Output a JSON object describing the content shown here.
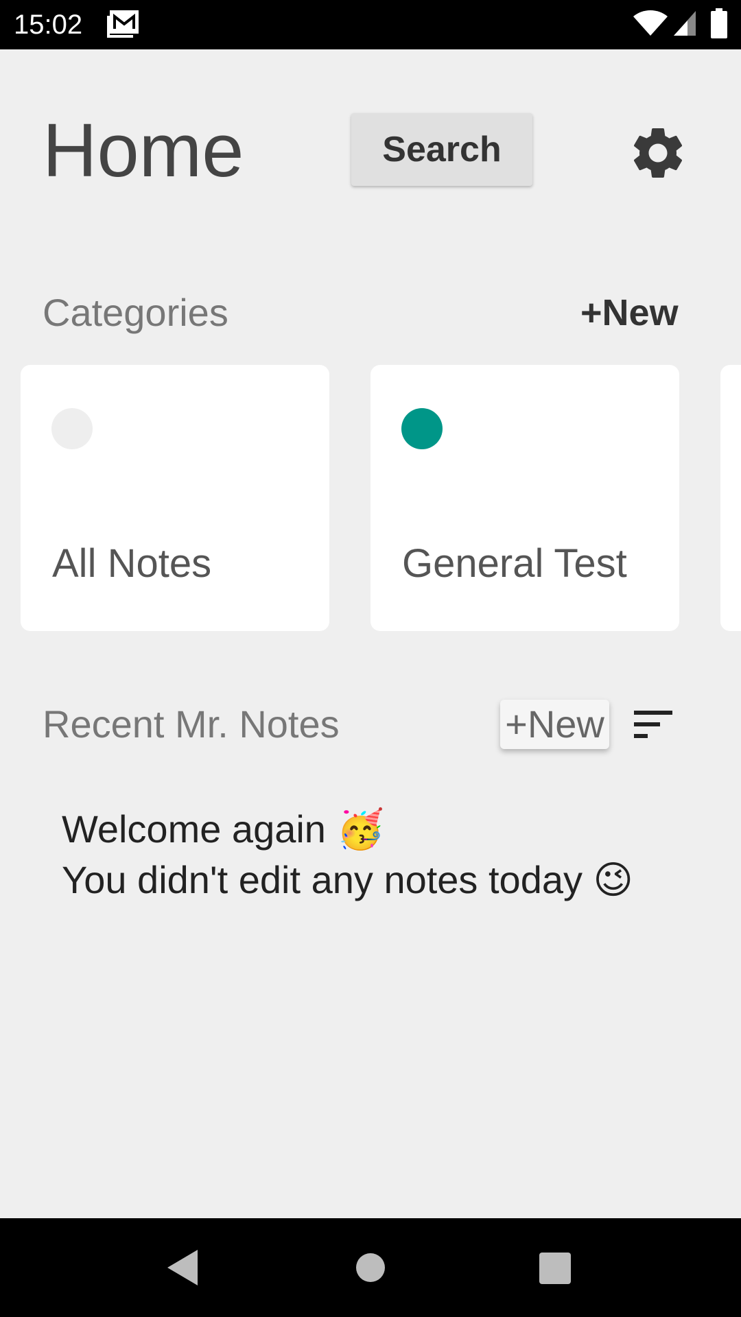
{
  "status_bar": {
    "time": "15:02",
    "icons": [
      "gmail-icon",
      "wifi-icon",
      "signal-icon",
      "battery-icon"
    ]
  },
  "header": {
    "title": "Home",
    "search_label": "Search",
    "settings_icon": "gear-icon"
  },
  "categories": {
    "title": "Categories",
    "new_label": "+New",
    "items": [
      {
        "label": "All Notes",
        "color": "#eeeeee"
      },
      {
        "label": "General Test",
        "color": "#009688"
      }
    ]
  },
  "recent": {
    "title": "Recent Mr. Notes",
    "new_label": "+New",
    "sort_icon": "sort-icon",
    "welcome_line1": "Welcome again 🥳",
    "welcome_line2": "You didn't edit any notes today 😉"
  },
  "nav_bar": {
    "icons": [
      "back-icon",
      "home-icon",
      "recents-icon"
    ]
  },
  "colors": {
    "background": "#efefef",
    "accent": "#009688"
  }
}
